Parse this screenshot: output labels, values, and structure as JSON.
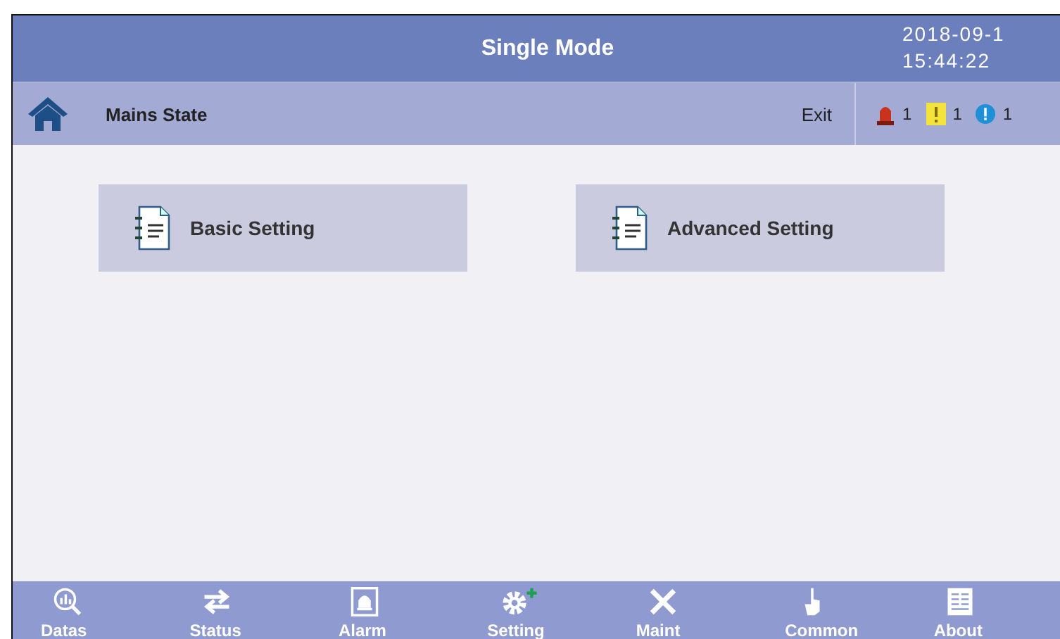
{
  "title_bar": {
    "title": "Single Mode",
    "date": "2018-09-1",
    "time": "15:44:22"
  },
  "sub_bar": {
    "label": "Mains State",
    "exit": "Exit",
    "alarms": [
      {
        "kind": "fault",
        "count": "1"
      },
      {
        "kind": "warning",
        "count": "1"
      },
      {
        "kind": "info",
        "count": "1"
      }
    ]
  },
  "settings": [
    {
      "label": "Basic Setting"
    },
    {
      "label": "Advanced Setting"
    }
  ],
  "nav": [
    {
      "kind": "datas",
      "label": "Datas"
    },
    {
      "kind": "status",
      "label": "Status"
    },
    {
      "kind": "alarm",
      "label": "Alarm"
    },
    {
      "kind": "setting",
      "label": "Setting"
    },
    {
      "kind": "maint",
      "label": "Maint"
    },
    {
      "kind": "common",
      "label": "Common"
    },
    {
      "kind": "about",
      "label": "About"
    }
  ]
}
